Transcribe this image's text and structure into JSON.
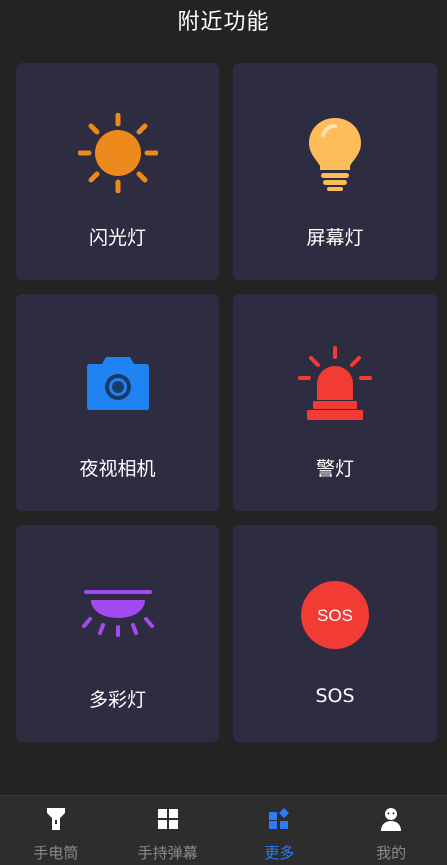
{
  "header": {
    "title": "附近功能"
  },
  "cards": [
    {
      "label": "闪光灯",
      "icon": "sun-icon",
      "color": "#ee8a1c"
    },
    {
      "label": "屏幕灯",
      "icon": "light-bulb-icon",
      "color": "#ffbd5a"
    },
    {
      "label": "夜视相机",
      "icon": "camera-icon",
      "color": "#1f83f2"
    },
    {
      "label": "警灯",
      "icon": "siren-icon",
      "color": "#f23b33"
    },
    {
      "label": "多彩灯",
      "icon": "ceiling-lamp-icon",
      "color": "#a349f0"
    },
    {
      "label": "SOS",
      "icon": "sos-icon",
      "color": "#f23b33",
      "badge_text": "SOS"
    }
  ],
  "tabbar": {
    "active_index": 2,
    "active_color": "#2b7cf6",
    "inactive_color": "#8a8a8a",
    "items": [
      {
        "label": "手电筒",
        "icon": "flashlight-icon"
      },
      {
        "label": "手持弹幕",
        "icon": "grid-icon"
      },
      {
        "label": "更多",
        "icon": "apps-more-icon"
      },
      {
        "label": "我的",
        "icon": "user-icon"
      }
    ]
  }
}
